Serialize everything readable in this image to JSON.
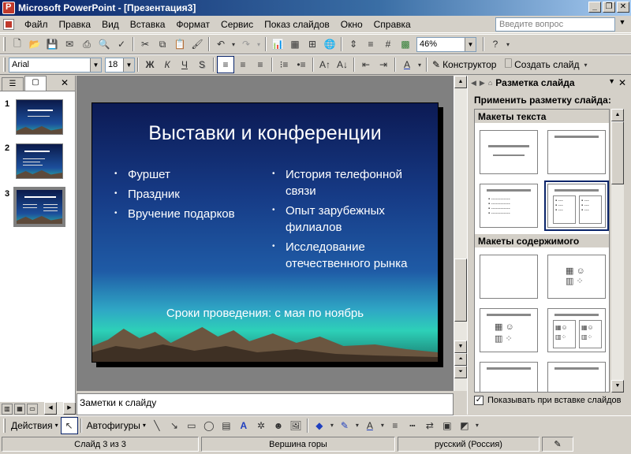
{
  "window": {
    "title": "Microsoft PowerPoint - [Презентация3]"
  },
  "menu": {
    "items": [
      "Файл",
      "Правка",
      "Вид",
      "Вставка",
      "Формат",
      "Сервис",
      "Показ слайдов",
      "Окно",
      "Справка"
    ],
    "help_placeholder": "Введите вопрос"
  },
  "toolbar": {
    "zoom": "46%",
    "font_name": "Arial",
    "font_size": "18",
    "bold": "Ж",
    "italic": "К",
    "underline": "Ч",
    "shadow": "S",
    "designer_label": "Конструктор",
    "new_slide_label": "Создать слайд"
  },
  "slides_panel": {
    "thumbnails": [
      {
        "number": "1"
      },
      {
        "number": "2"
      },
      {
        "number": "3"
      }
    ]
  },
  "slide": {
    "title": "Выставки и конференции",
    "left_bullets": [
      "Фуршет",
      "Праздник",
      "Вручение подарков"
    ],
    "right_bullets": [
      "История телефонной связи",
      "Опыт зарубежных филиалов",
      "Исследование отечественного рынка"
    ],
    "footer": "Сроки проведения: с мая по ноябрь"
  },
  "notes": {
    "placeholder": "Заметки к слайду"
  },
  "task_pane": {
    "title": "Разметка слайда",
    "apply_label": "Применить разметку слайда:",
    "section_text": "Макеты текста",
    "section_content": "Макеты содержимого",
    "show_on_insert": "Показывать при вставке слайдов"
  },
  "drawing_toolbar": {
    "actions_label": "Действия",
    "autoshapes_label": "Автофигуры"
  },
  "status": {
    "slide_info": "Слайд 3 из 3",
    "design": "Вершина горы",
    "language": "русский (Россия)"
  }
}
